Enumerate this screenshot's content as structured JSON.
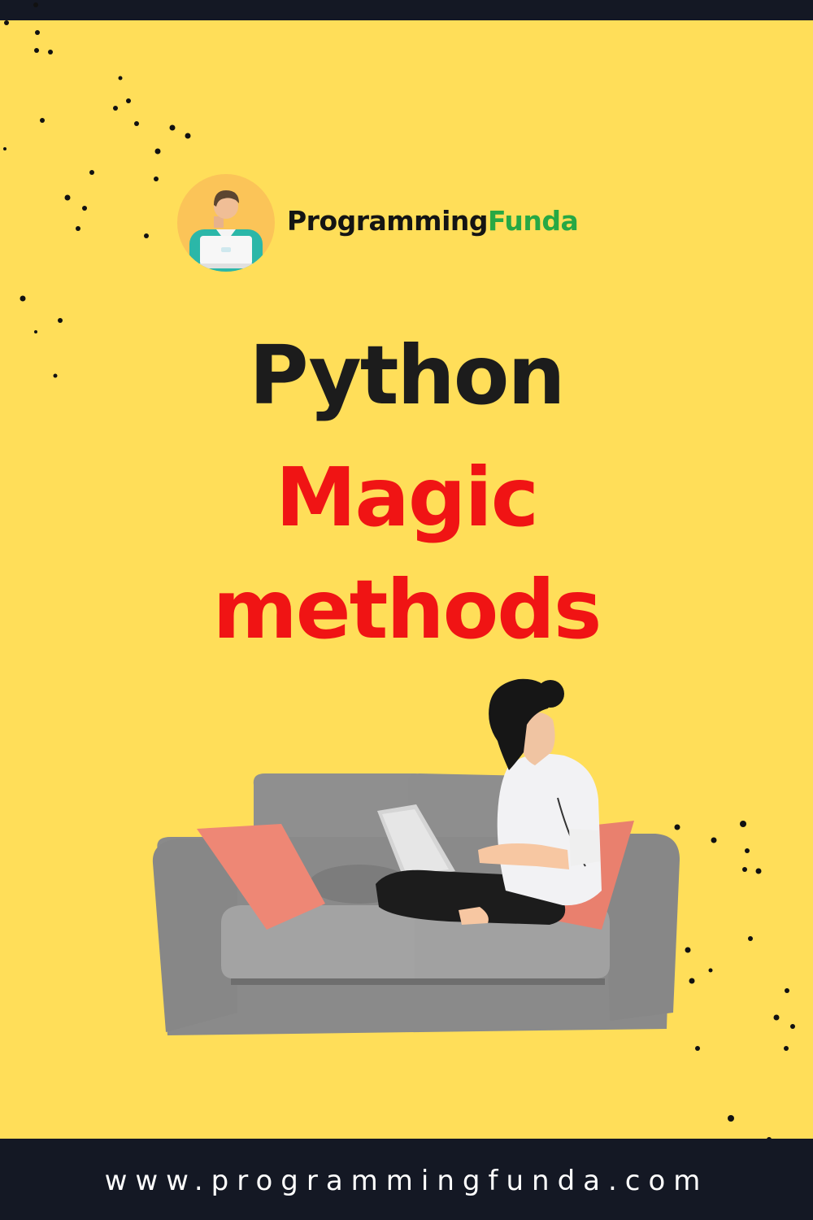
{
  "brand": {
    "name_part1": "Programming",
    "name_part2": "Funda",
    "accent_color": "#27A844",
    "text_color": "#141414",
    "logo_icon": "person-with-laptop-icon"
  },
  "title": {
    "line1": "Python",
    "line2": "Magic",
    "line3": "methods",
    "line1_color": "#1C1C1C",
    "highlight_color": "#F01414"
  },
  "illustration": {
    "icon": "woman-on-sofa-with-laptop-illustration"
  },
  "footer": {
    "url": "www.programmingfunda.com"
  },
  "colors": {
    "background": "#FFDE59",
    "bars": "#141824"
  }
}
